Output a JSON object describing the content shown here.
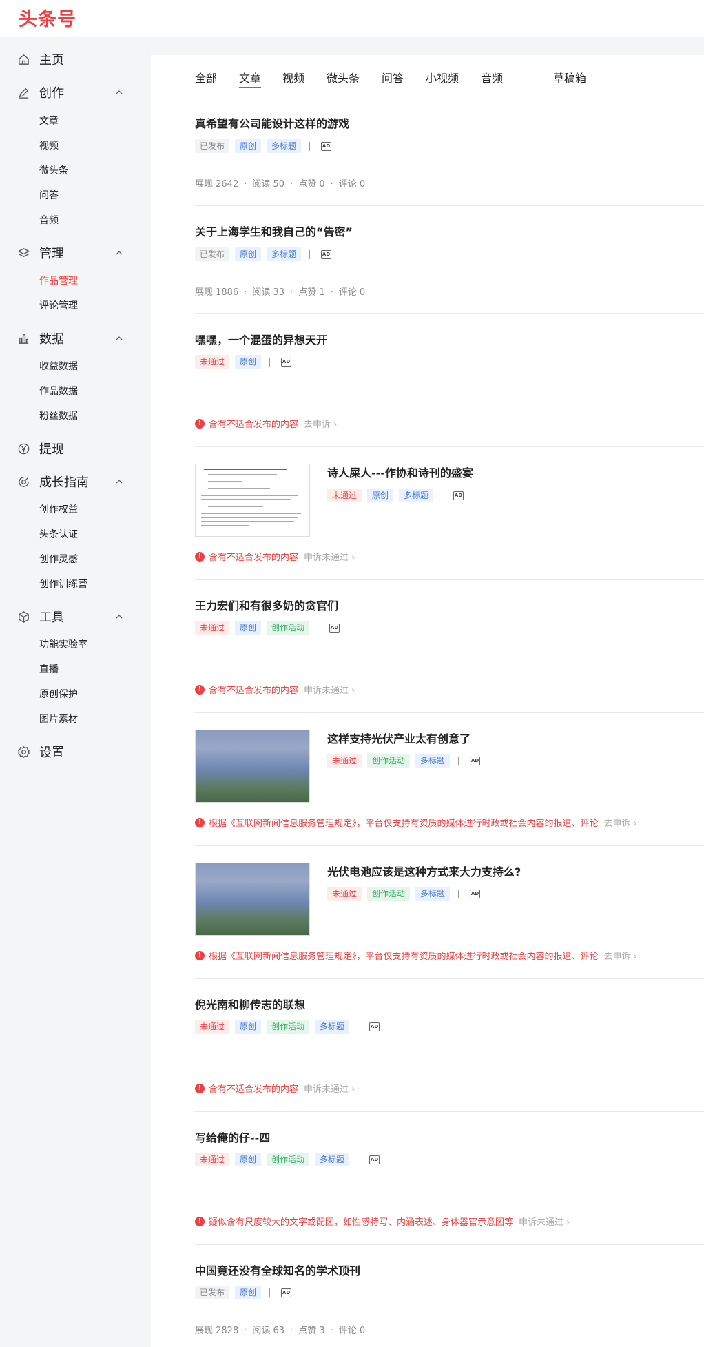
{
  "header": {
    "logo": "头条号"
  },
  "sidebar": {
    "home": "主页",
    "create": {
      "label": "创作",
      "items": [
        "文章",
        "视频",
        "微头条",
        "问答",
        "音频"
      ]
    },
    "manage": {
      "label": "管理",
      "items": [
        "作品管理",
        "评论管理"
      ]
    },
    "data": {
      "label": "数据",
      "items": [
        "收益数据",
        "作品数据",
        "粉丝数据"
      ]
    },
    "withdraw": "提现",
    "growth": {
      "label": "成长指南",
      "items": [
        "创作权益",
        "头条认证",
        "创作灵感",
        "创作训练营"
      ]
    },
    "tools": {
      "label": "工具",
      "items": [
        "功能实验室",
        "直播",
        "原创保护",
        "图片素材"
      ]
    },
    "settings": "设置"
  },
  "tabs": [
    "全部",
    "文章",
    "视频",
    "微头条",
    "问答",
    "小视频",
    "音频",
    "草稿箱"
  ],
  "tags": {
    "published": "已发布",
    "original": "原创",
    "multi_title": "多标题",
    "rejected": "未通过",
    "activity": "创作活动",
    "ad": "AD"
  },
  "stats_labels": {
    "views": "展现",
    "reads": "阅读",
    "likes": "点赞",
    "comments": "评论"
  },
  "articles": [
    {
      "title": "真希望有公司能设计这样的游戏",
      "stats": [
        "展现 2642",
        "阅读 50",
        "点赞 0",
        "评论 0"
      ]
    },
    {
      "title": "关于上海学生和我自己的“告密”",
      "stats": [
        "展现 1886",
        "阅读 33",
        "点赞 1",
        "评论 0"
      ]
    },
    {
      "title": "嘿嘿，一个混蛋的异想天开",
      "warn": "含有不适合发布的内容",
      "link": "去申诉 ›"
    },
    {
      "title": "诗人屎人---作协和诗刊的盛宴",
      "warn": "含有不适合发布的内容",
      "link": "申诉未通过 ›"
    },
    {
      "title": "王力宏们和有很多奶的贪官们",
      "warn": "含有不适合发布的内容",
      "link": "申诉未通过 ›"
    },
    {
      "title": "这样支持光伏产业太有创意了",
      "warn": "根据《互联网新闻信息服务管理规定》，平台仅支持有资质的媒体进行时政或社会内容的报道、评论",
      "link": "去申诉 ›"
    },
    {
      "title": "光伏电池应该是这种方式来大力支持么?",
      "warn": "根据《互联网新闻信息服务管理规定》，平台仅支持有资质的媒体进行时政或社会内容的报道、评论",
      "link": "去申诉 ›"
    },
    {
      "title": "倪光南和柳传志的联想",
      "warn": "含有不适合发布的内容",
      "link": "申诉未通过 ›"
    },
    {
      "title": "写给俺的仔--四",
      "warn": "疑似含有尺度较大的文字或配图，如性感特写、内涵表述、身体器官示意图等",
      "link": "申诉未通过 ›"
    },
    {
      "title": "中国竟还没有全球知名的学术顶刊",
      "stats": [
        "展现 2828",
        "阅读 63",
        "点赞 3",
        "评论 0"
      ]
    }
  ],
  "colors": {
    "brand": "#f04142",
    "tag_blue": "#4a7bd6",
    "tag_green": "#3bb06b"
  }
}
